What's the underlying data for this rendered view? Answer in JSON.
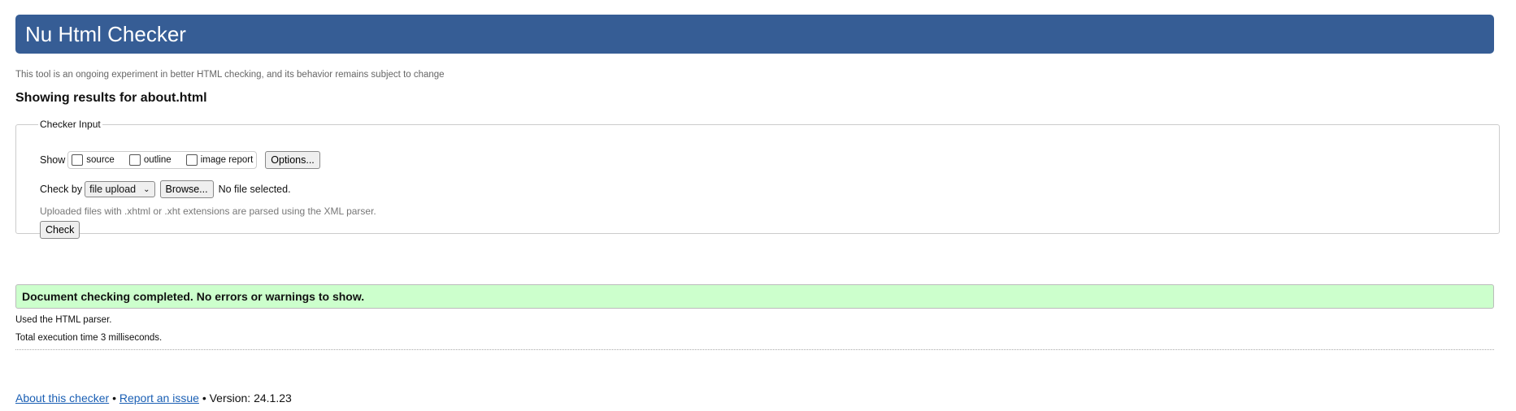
{
  "header": {
    "title": "Nu Html Checker"
  },
  "subtitle": "This tool is an ongoing experiment in better HTML checking, and its behavior remains subject to change",
  "heading": "Showing results for about.html",
  "checker_input": {
    "legend": "Checker Input",
    "show_label": "Show",
    "show_options": [
      {
        "label": "source",
        "checked": false
      },
      {
        "label": "outline",
        "checked": false
      },
      {
        "label": "image report",
        "checked": false
      }
    ],
    "options_button": "Options...",
    "check_by_label": "Check by",
    "check_by_value": "file upload",
    "browse_button": "Browse...",
    "file_status": "No file selected.",
    "hint": "Uploaded files with .xhtml or .xht extensions are parsed using the XML parser.",
    "check_button": "Check"
  },
  "result": {
    "message": "Document checking completed. No errors or warnings to show.",
    "parser": "Used the HTML parser.",
    "time": "Total execution time 3 milliseconds.",
    "success_color": "#ccffcc"
  },
  "footer": {
    "about": "About this checker",
    "sep": "•",
    "report": "Report an issue",
    "version": "• Version: 24.1.23"
  },
  "colors": {
    "header": "#365d95",
    "link": "#1a5fb4"
  }
}
